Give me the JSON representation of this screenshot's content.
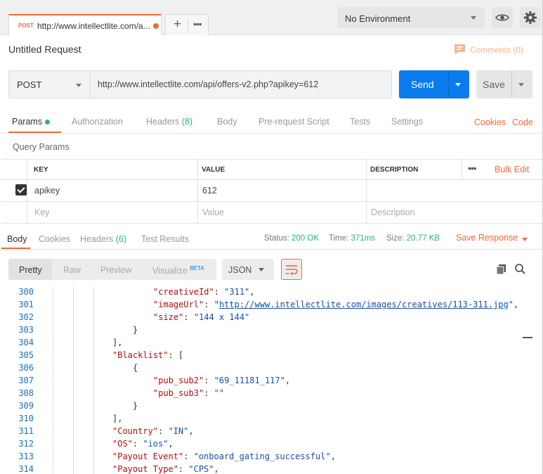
{
  "tab": {
    "method": "POST",
    "url": "http://www.intellectlite.com/a..."
  },
  "environment": {
    "selected": "No Environment"
  },
  "request": {
    "title": "Untitled Request",
    "comments_label": "Comments (0)",
    "method": "POST",
    "url": "http://www.intellectlite.com/api/offers-v2.php?apikey=612",
    "send_label": "Send",
    "save_label": "Save"
  },
  "request_tabs": [
    {
      "label": "Params"
    },
    {
      "label": "Authorization"
    },
    {
      "label": "Headers",
      "count": "(8)"
    },
    {
      "label": "Body"
    },
    {
      "label": "Pre-request Script"
    },
    {
      "label": "Tests"
    },
    {
      "label": "Settings"
    }
  ],
  "request_links": {
    "cookies": "Cookies",
    "code": "Code"
  },
  "query_params": {
    "title": "Query Params",
    "headers": {
      "key": "KEY",
      "value": "VALUE",
      "description": "DESCRIPTION"
    },
    "bulk_edit": "Bulk Edit",
    "rows": [
      {
        "key": "apikey",
        "value": "612",
        "description": "",
        "checked": true
      }
    ],
    "placeholder": {
      "key": "Key",
      "value": "Value",
      "description": "Description"
    }
  },
  "response_tabs": [
    {
      "label": "Body"
    },
    {
      "label": "Cookies"
    },
    {
      "label": "Headers",
      "count": "(6)"
    },
    {
      "label": "Test Results"
    }
  ],
  "response_status": {
    "status_label": "Status:",
    "status_value": "200 OK",
    "time_label": "Time:",
    "time_value": "371ms",
    "size_label": "Size:",
    "size_value": "20.77 KB",
    "save_response": "Save Response"
  },
  "view_options": {
    "pretty": "Pretty",
    "raw": "Raw",
    "preview": "Preview",
    "visualize": "Visualize",
    "beta": "BETA",
    "format": "JSON"
  },
  "code_lines": [
    {
      "n": "300",
      "indent": 2,
      "parts": [
        [
          "k",
          "\"creativeId\""
        ],
        [
          "p",
          ": "
        ],
        [
          "s",
          "\"311\""
        ],
        [
          "p",
          ","
        ]
      ]
    },
    {
      "n": "301",
      "indent": 2,
      "parts": [
        [
          "k",
          "\"imageUrl\""
        ],
        [
          "p",
          ": \""
        ],
        [
          "u",
          "http://www.intellectlite.com/images/creatives/113-311.jpg"
        ],
        [
          "s",
          "\""
        ],
        [
          "p",
          ","
        ]
      ]
    },
    {
      "n": "302",
      "indent": 2,
      "parts": [
        [
          "k",
          "\"size\""
        ],
        [
          "p",
          ": "
        ],
        [
          "s",
          "\"144 x 144\""
        ]
      ]
    },
    {
      "n": "303",
      "indent": 1.5,
      "parts": [
        [
          "p",
          "}"
        ]
      ]
    },
    {
      "n": "304",
      "indent": 1,
      "parts": [
        [
          "p",
          "],"
        ]
      ]
    },
    {
      "n": "305",
      "indent": 1,
      "parts": [
        [
          "k",
          "\"Blacklist\""
        ],
        [
          "p",
          ": ["
        ]
      ]
    },
    {
      "n": "306",
      "indent": 1.5,
      "parts": [
        [
          "p",
          "{"
        ]
      ]
    },
    {
      "n": "307",
      "indent": 2,
      "parts": [
        [
          "k",
          "\"pub_sub2\""
        ],
        [
          "p",
          ": "
        ],
        [
          "s",
          "\"69_11181_117\""
        ],
        [
          "p",
          ","
        ]
      ]
    },
    {
      "n": "308",
      "indent": 2,
      "parts": [
        [
          "k",
          "\"pub_sub3\""
        ],
        [
          "p",
          ": "
        ],
        [
          "s",
          "\"\""
        ]
      ]
    },
    {
      "n": "309",
      "indent": 1.5,
      "parts": [
        [
          "p",
          "}"
        ]
      ]
    },
    {
      "n": "310",
      "indent": 1,
      "parts": [
        [
          "p",
          "],"
        ]
      ]
    },
    {
      "n": "311",
      "indent": 1,
      "parts": [
        [
          "k",
          "\"Country\""
        ],
        [
          "p",
          ": "
        ],
        [
          "s",
          "\"IN\""
        ],
        [
          "p",
          ","
        ]
      ]
    },
    {
      "n": "312",
      "indent": 1,
      "parts": [
        [
          "k",
          "\"OS\""
        ],
        [
          "p",
          ": "
        ],
        [
          "s",
          "\"ios\""
        ],
        [
          "p",
          ","
        ]
      ]
    },
    {
      "n": "313",
      "indent": 1,
      "parts": [
        [
          "k",
          "\"Payout Event\""
        ],
        [
          "p",
          ": "
        ],
        [
          "s",
          "\"onboard_gating_successful\""
        ],
        [
          "p",
          ","
        ]
      ]
    },
    {
      "n": "314",
      "indent": 1,
      "parts": [
        [
          "k",
          "\"Payout Type\""
        ],
        [
          "p",
          ": "
        ],
        [
          "s",
          "\"CPS\""
        ],
        [
          "p",
          ","
        ]
      ]
    }
  ]
}
